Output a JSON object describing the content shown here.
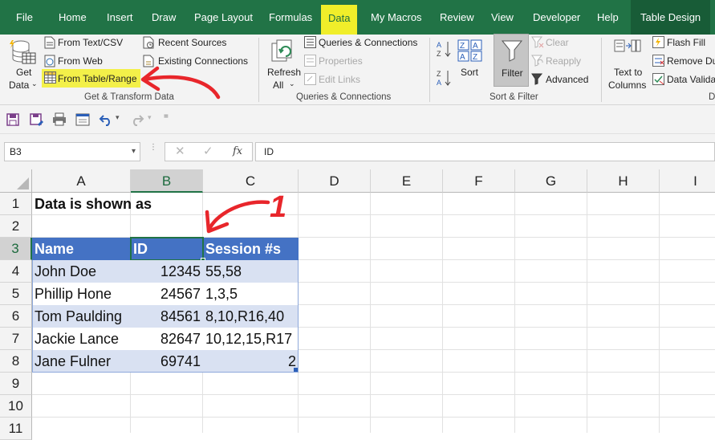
{
  "menu": {
    "items": [
      "File",
      "Home",
      "Insert",
      "Draw",
      "Page Layout",
      "Formulas",
      "Data",
      "My Macros",
      "Review",
      "View",
      "Developer",
      "Help",
      "Table Design"
    ],
    "active": "Data"
  },
  "ribbon": {
    "get_transform": {
      "get_data_l1": "Get",
      "get_data_l2": "Data",
      "from_text_csv": "From Text/CSV",
      "from_web": "From Web",
      "from_table_range": "From Table/Range",
      "recent_sources": "Recent Sources",
      "existing_connections": "Existing Connections",
      "label": "Get & Transform Data"
    },
    "queries": {
      "refresh_l1": "Refresh",
      "refresh_l2": "All",
      "queries_connections": "Queries & Connections",
      "properties": "Properties",
      "edit_links": "Edit Links",
      "label": "Queries & Connections"
    },
    "sort_filter": {
      "sort": "Sort",
      "filter": "Filter",
      "clear": "Clear",
      "reapply": "Reapply",
      "advanced": "Advanced",
      "label": "Sort & Filter"
    },
    "data_tools": {
      "text_to_columns_l1": "Text to",
      "text_to_columns_l2": "Columns",
      "flash_fill": "Flash Fill",
      "remove_duplicates": "Remove Du",
      "data_validation": "Data Validat",
      "label_partial": "D"
    }
  },
  "formula_bar": {
    "name_box": "B3",
    "fx": "fx",
    "formula": "ID"
  },
  "grid": {
    "columns": [
      "A",
      "B",
      "C",
      "D",
      "E",
      "F",
      "G",
      "H",
      "I"
    ],
    "rows": [
      "1",
      "2",
      "3",
      "4",
      "5",
      "6",
      "7",
      "8",
      "9",
      "10",
      "11"
    ],
    "a1": "Data is shown as",
    "table": {
      "headers": [
        "Name",
        "ID",
        "Session #s"
      ],
      "rows": [
        [
          "John Doe",
          "12345",
          "55,58"
        ],
        [
          "Phillip Hone",
          "24567",
          "1,3,5"
        ],
        [
          "Tom Paulding",
          "84561",
          "8,10,R16,40"
        ],
        [
          "Jackie Lance",
          "82647",
          "10,12,15,R17"
        ],
        [
          "Jane Fulner",
          "69741",
          "2"
        ]
      ]
    }
  },
  "annotations": {
    "marker_text": "1",
    "color": "#e8262b",
    "highlight_color": "#f3f049"
  },
  "colors": {
    "excel_green": "#217346",
    "table_header": "#4472c4",
    "table_band": "#d9e1f2"
  }
}
